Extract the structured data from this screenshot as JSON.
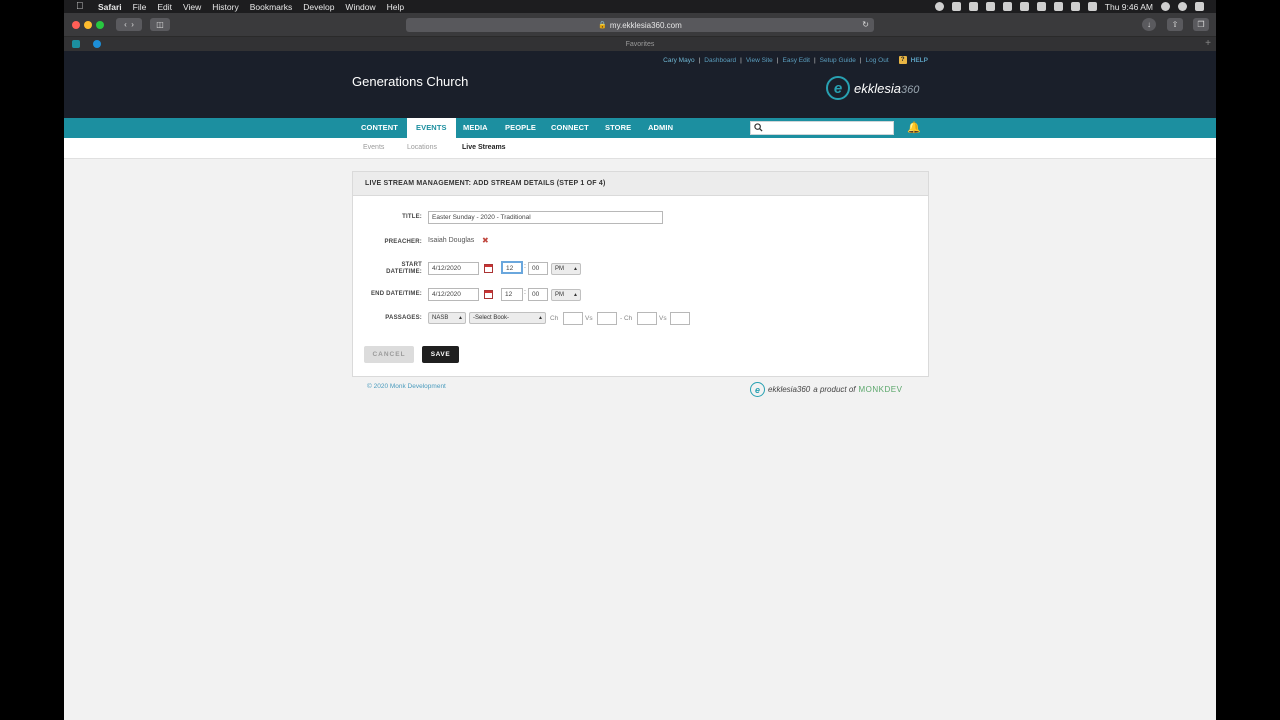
{
  "menubar": {
    "app": "Safari",
    "items": [
      "File",
      "Edit",
      "View",
      "History",
      "Bookmarks",
      "Develop",
      "Window",
      "Help"
    ],
    "clock": "Thu 9:46 AM"
  },
  "browser": {
    "url": "my.ekklesia360.com",
    "favorites_label": "Favorites"
  },
  "site": {
    "church_name": "Generations Church",
    "user_name": "Cary Mayo",
    "util_links": [
      "Dashboard",
      "View Site",
      "Easy Edit",
      "Setup Guide",
      "Log Out"
    ],
    "help_label": "HELP",
    "logo_word": "ekklesia",
    "logo_num": "360",
    "nav": [
      "CONTENT",
      "EVENTS",
      "MEDIA",
      "PEOPLE",
      "CONNECT",
      "STORE",
      "ADMIN"
    ],
    "active_nav": "EVENTS",
    "subnav": [
      "Events",
      "Locations",
      "Live Streams"
    ],
    "active_subnav": "Live Streams",
    "search_placeholder": ""
  },
  "form": {
    "heading": "LIVE STREAM MANAGEMENT: ADD STREAM DETAILS (STEP 1 OF 4)",
    "title_label": "TITLE:",
    "title_value": "Easter Sunday - 2020 - Traditional",
    "preacher_label": "PREACHER:",
    "preacher_value": "Isaiah Douglas",
    "start_label_1": "START",
    "start_label_2": "DATE/TIME:",
    "start_date": "4/12/2020",
    "start_hour": "12",
    "start_min": "00",
    "start_ampm": "PM",
    "end_label": "END DATE/TIME:",
    "end_date": "4/12/2020",
    "end_hour": "12",
    "end_min": "00",
    "end_ampm": "PM",
    "passages_label": "PASSAGES:",
    "translation": "NASB",
    "book": "-Select Book-",
    "ch_label": "Ch",
    "vs_label": "Vs",
    "dash_ch_label": "- Ch",
    "cancel_label": "CANCEL",
    "save_label": "SAVE"
  },
  "footer": {
    "copyright": "© 2020 Monk Development",
    "logo_word": "ekklesia",
    "logo_num": "360",
    "tagline": "a product of",
    "monk": "MONKDEV"
  },
  "colors": {
    "header_bg": "#1a1f2a",
    "nav_bg": "#1c8fa0",
    "accent": "#28a1b2",
    "link": "#4a9bbd"
  }
}
